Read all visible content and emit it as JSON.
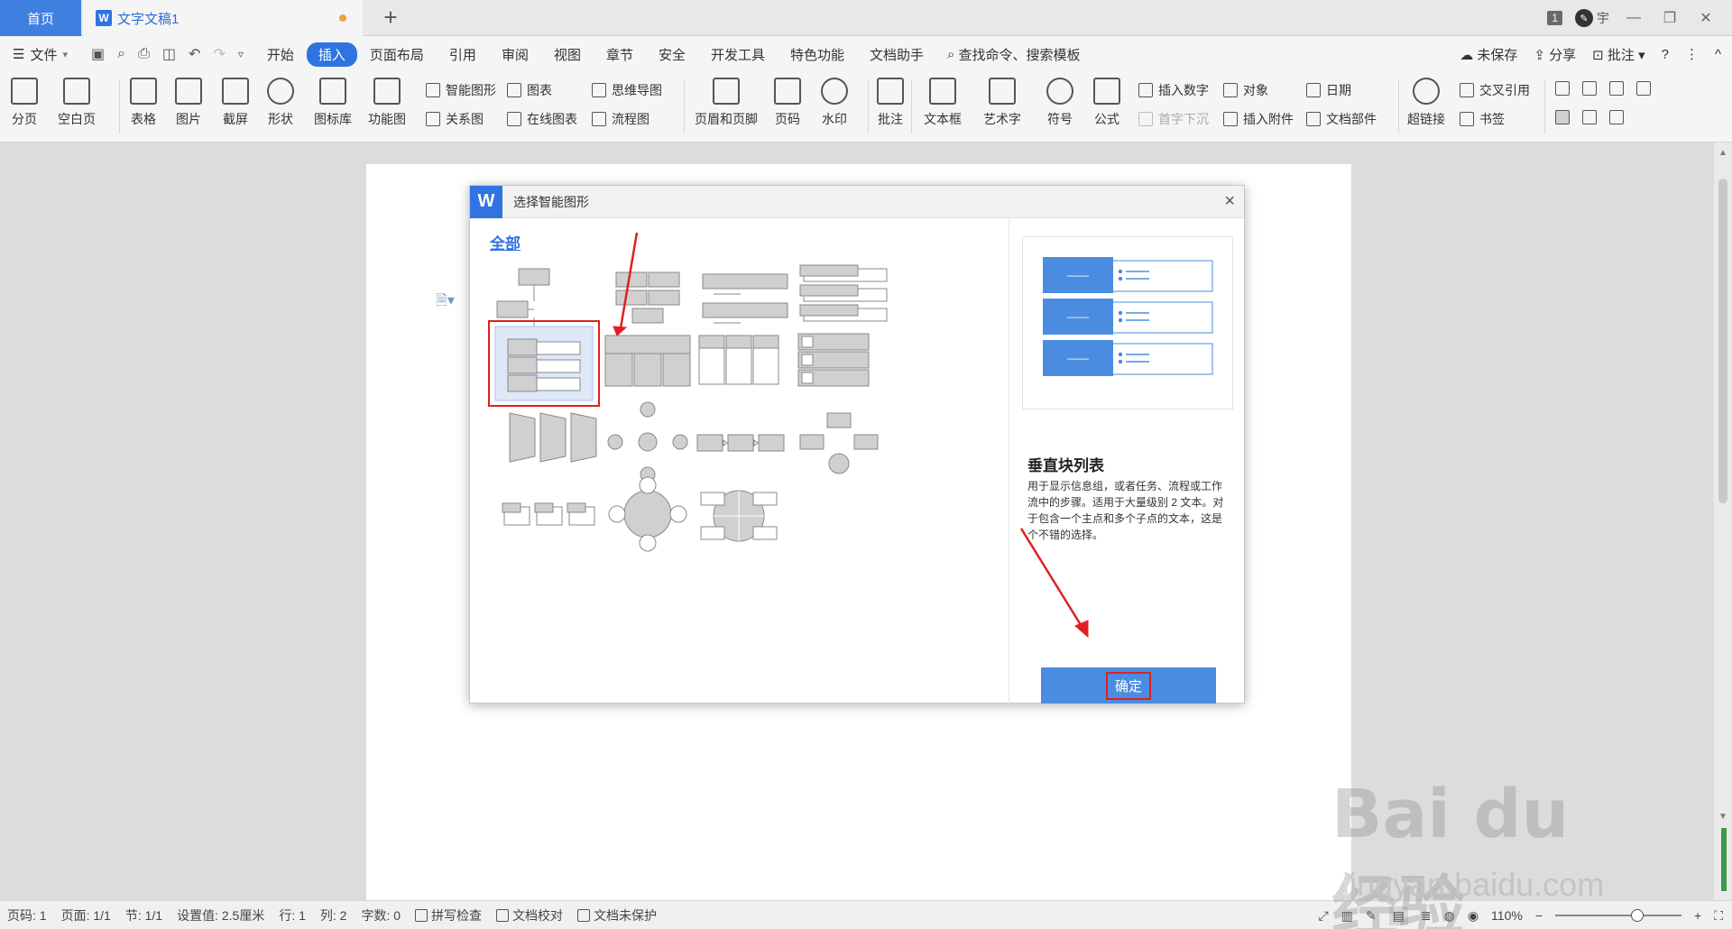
{
  "titlebar": {
    "home_tab": "首页",
    "doc_tab": "文字文稿1",
    "new_tab": "+",
    "page_count_badge": "1",
    "user_initial": "宇"
  },
  "menubar": {
    "file": "文件",
    "items": [
      "开始",
      "插入",
      "页面布局",
      "引用",
      "审阅",
      "视图",
      "章节",
      "安全",
      "开发工具",
      "特色功能",
      "文档助手"
    ],
    "active": "插入",
    "search": "查找命令、搜索模板",
    "unsaved": "未保存",
    "share": "分享",
    "comment": "批注"
  },
  "ribbon": {
    "page_break": "分页",
    "blank_page": "空白页",
    "table": "表格",
    "picture": "图片",
    "screenshot": "截屏",
    "shape": "形状",
    "icon_lib": "图标库",
    "function_chart": "功能图",
    "smart_art": "智能图形",
    "chart": "图表",
    "mind_map": "思维导图",
    "relation_chart": "关系图",
    "online_chart": "在线图表",
    "flowchart": "流程图",
    "header_footer": "页眉和页脚",
    "page_number": "页码",
    "watermark": "水印",
    "comment": "批注",
    "textbox": "文本框",
    "wordart": "艺术字",
    "symbol": "符号",
    "formula": "公式",
    "insert_number": "插入数字",
    "object": "对象",
    "date": "日期",
    "drop_cap": "首字下沉",
    "attachment": "插入附件",
    "doc_parts": "文档部件",
    "hyperlink": "超链接",
    "cross_ref": "交叉引用",
    "bookmark": "书签"
  },
  "dialog": {
    "title": "选择智能图形",
    "close": "×",
    "category": "全部",
    "preview_title": "垂直块列表",
    "preview_desc": "用于显示信息组，或者任务、流程或工作流中的步骤。适用于大量级别 2 文本。对于包含一个主点和多个子点的文本，这是个不错的选择。",
    "ok": "确定",
    "selected_index": 4,
    "preview_dash": "——"
  },
  "statusbar": {
    "page_code": "页码: 1",
    "page": "页面: 1/1",
    "section": "节: 1/1",
    "setting": "设置值: 2.5厘米",
    "row": "行: 1",
    "col": "列: 2",
    "words": "字数: 0",
    "spell": "拼写检查",
    "proof": "文档校对",
    "protect": "文档未保护",
    "zoom": "110%"
  },
  "watermark": {
    "brand": "Bai du 经验",
    "url": "jingyan.baidu.com"
  },
  "colors": {
    "accent": "#2f74e0",
    "highlight": "#e02020",
    "preview_block": "#4a8de0"
  }
}
